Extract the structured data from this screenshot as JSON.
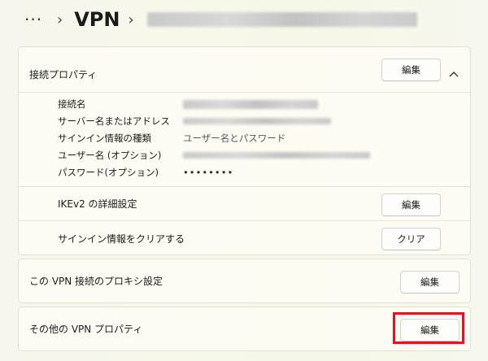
{
  "breadcrumb": {
    "more": "···",
    "chevron": "›",
    "title": "VPN",
    "connection_name_redacted": ""
  },
  "props_card": {
    "title": "接続プロパティ",
    "edit_label": "編集",
    "details": [
      {
        "key": "接続名",
        "value": ""
      },
      {
        "key": "サーバー名またはアドレス",
        "value": ""
      },
      {
        "key": "サインイン情報の種類",
        "value": "ユーザー名とパスワード"
      },
      {
        "key": "ユーザー名 (オプション)",
        "value": ""
      },
      {
        "key": "パスワード(オプション)",
        "value": "••••••••"
      }
    ],
    "ikev2": {
      "label": "IKEv2 の詳細設定",
      "button": "編集"
    },
    "clear": {
      "label": "サインイン情報をクリアする",
      "button": "クリア"
    }
  },
  "proxy_card": {
    "label": "この VPN 接続のプロキシ設定",
    "button": "編集"
  },
  "other_card": {
    "label": "その他の VPN プロパティ",
    "button": "編集"
  },
  "colors": {
    "highlight": "#e3141e",
    "background": "#f6f7ec"
  }
}
